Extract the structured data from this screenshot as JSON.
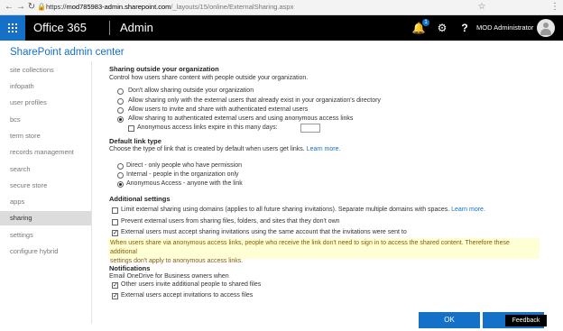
{
  "browser": {
    "protocol": "https://",
    "host": "mod785983-admin.sharepoint.com",
    "path": "/_layouts/15/online/ExternalSharing.aspx"
  },
  "suite": {
    "brand": "Office 365",
    "app": "Admin",
    "notification_count": "1",
    "user_name": "MOD Administrator",
    "accent": "#1570c7"
  },
  "page": {
    "title": "SharePoint admin center"
  },
  "nav": {
    "items": [
      {
        "label": "site collections"
      },
      {
        "label": "infopath"
      },
      {
        "label": "user profiles"
      },
      {
        "label": "bcs"
      },
      {
        "label": "term store"
      },
      {
        "label": "records management"
      },
      {
        "label": "search"
      },
      {
        "label": "secure store"
      },
      {
        "label": "apps"
      },
      {
        "label": "sharing"
      },
      {
        "label": "settings"
      },
      {
        "label": "configure hybrid"
      }
    ],
    "active": "sharing"
  },
  "sharing_outside": {
    "heading": "Sharing outside your organization",
    "description": "Control how users share content with people outside your organization.",
    "options": [
      {
        "label": "Don't allow sharing outside your organization",
        "selected": false
      },
      {
        "label": "Allow sharing only with the external users that already exist in your organization's directory",
        "selected": false
      },
      {
        "label": "Allow users to invite and share with authenticated external users",
        "selected": false
      },
      {
        "label": "Allow sharing to authenticated external users and using anonymous access links",
        "selected": true
      }
    ],
    "expire_label": "Anonymous access links expire in this many days:",
    "expire_checked": false,
    "expire_value": ""
  },
  "default_link": {
    "heading": "Default link type",
    "description": "Choose the type of link that is created by default when users get links.",
    "learn_more": "Learn more.",
    "options": [
      {
        "label": "Direct - only people who have permission",
        "selected": false
      },
      {
        "label": "Internal - people in the organization only",
        "selected": false
      },
      {
        "label": "Anonymous Access - anyone with the link",
        "selected": true
      }
    ]
  },
  "additional": {
    "heading": "Additional settings",
    "limit_label": "Limit external sharing using domains (applies to all future sharing invitations). Separate multiple domains with spaces.",
    "limit_learn_more": "Learn more.",
    "limit_checked": false,
    "prevent_label": "Prevent external users from sharing files, folders, and sites that they don't own",
    "prevent_checked": false,
    "accept_label": "External users must accept sharing invitations using the same account that the invitations were sent to",
    "accept_checked": true,
    "notice_line1": "When users share via anonymous access links, people who receive the link don't need to sign in to access the shared content. Therefore these additional",
    "notice_line2": "settings don't apply to anonymous access links."
  },
  "notifications": {
    "heading": "Notifications",
    "description": "Email OneDrive for Business owners when",
    "options": [
      {
        "label": "Other users invite additional people to shared files",
        "checked": true
      },
      {
        "label": "External users accept invitations to access files",
        "checked": true
      }
    ]
  },
  "buttons": {
    "ok": "OK",
    "feedback": "Feedback"
  }
}
